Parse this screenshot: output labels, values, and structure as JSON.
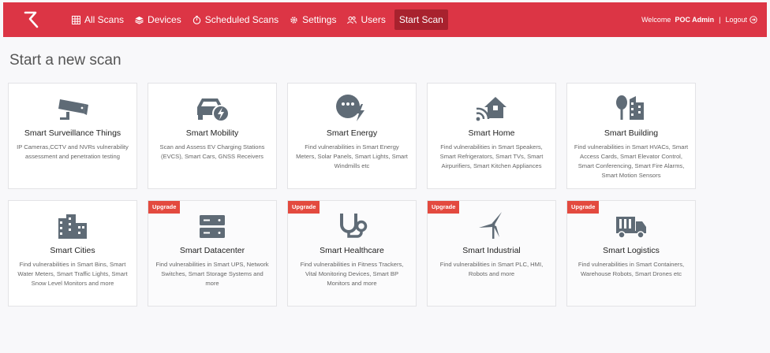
{
  "nav": {
    "items": [
      {
        "label": "All Scans",
        "icon": "table-icon"
      },
      {
        "label": "Devices",
        "icon": "layers-icon"
      },
      {
        "label": "Scheduled Scans",
        "icon": "timer-icon"
      },
      {
        "label": "Settings",
        "icon": "gear-icon"
      },
      {
        "label": "Users",
        "icon": "users-icon"
      }
    ],
    "active_label": "Start Scan",
    "welcome": "Welcome",
    "user": "POC Admin",
    "separator": "|",
    "logout": "Logout"
  },
  "page": {
    "title": "Start a new scan"
  },
  "badge_label": "Upgrade",
  "cards": [
    {
      "title": "Smart Surveillance Things",
      "desc": "IP Cameras,CCTV and NVRs vulnerability assessment and penetration testing",
      "icon": "cctv-camera-icon",
      "locked": false
    },
    {
      "title": "Smart Mobility",
      "desc": "Scan and Assess EV Charging Stations (EVCS), Smart Cars, GNSS Receivers",
      "icon": "ev-car-icon",
      "locked": false
    },
    {
      "title": "Smart Energy",
      "desc": "Find vulnerabilities in Smart Energy Meters, Solar Panels, Smart Lights, Smart Windmills etc",
      "icon": "bulb-bolt-icon",
      "locked": false
    },
    {
      "title": "Smart Home",
      "desc": "Find vulnerabilities in Smart Speakers, Smart Refrigerators, Smart TVs, Smart Airpurifiers, Smart Kitchen Appliances",
      "icon": "smart-home-icon",
      "locked": false
    },
    {
      "title": "Smart Building",
      "desc": "Find vulnerabilities in Smart HVACs, Smart Access Cards, Smart Elevator Control, Smart Conferencing, Smart Fire Alarms, Smart Motion Sensors",
      "icon": "building-icon",
      "locked": false
    },
    {
      "title": "Smart Cities",
      "desc": "Find vulnerabilities in Smart Bins, Smart Water Meters, Smart Traffic Lights, Smart Snow Level Monitors and more",
      "icon": "city-icon",
      "locked": false
    },
    {
      "title": "Smart Datacenter",
      "desc": "Find vulnerabilities in Smart UPS, Network Switches, Smart Storage Systems and more",
      "icon": "server-icon",
      "locked": true
    },
    {
      "title": "Smart Healthcare",
      "desc": "Find vulnerabilities in Fitness Trackers, Vital Monitoring Devices, Smart BP Monitors and more",
      "icon": "stethoscope-icon",
      "locked": true
    },
    {
      "title": "Smart Industrial",
      "desc": "Find vulnerabilities in Smart PLC, HMI, Robots and more",
      "icon": "wind-turbine-icon",
      "locked": true
    },
    {
      "title": "Smart Logistics",
      "desc": "Find vulnerabilities in Smart Containers, Warehouse Robots, Smart Drones etc",
      "icon": "truck-icon",
      "locked": true
    }
  ],
  "colors": {
    "brand": "#dc3545",
    "active_nav": "#a8222e",
    "badge": "#e34a3f",
    "icon": "#5f6b76"
  }
}
